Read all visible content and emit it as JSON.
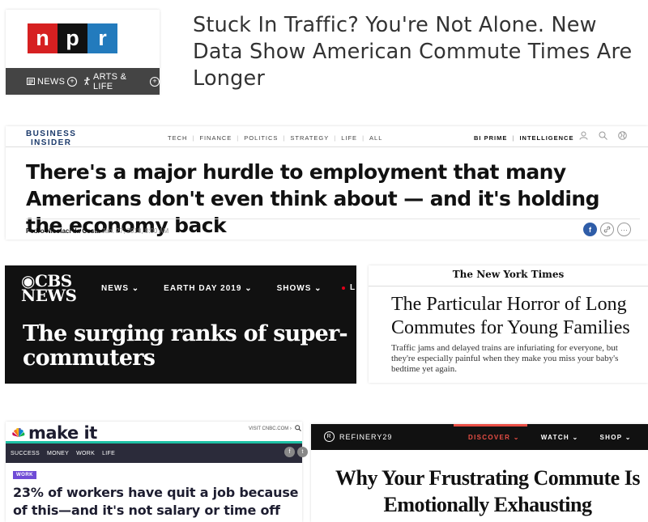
{
  "npr": {
    "logo_letters": [
      "n",
      "p",
      "r"
    ],
    "logo_colors": [
      "#d62021",
      "#111111",
      "#237bbd"
    ],
    "nav": [
      {
        "label": "NEWS",
        "icon": "list-icon"
      },
      {
        "label": "ARTS & LIFE",
        "icon": "dancer-icon"
      }
    ],
    "headline": "Stuck In Traffic? You're Not Alone. New Data Show American Commute Times Are Longer"
  },
  "business_insider": {
    "logo_line1": "BUSINESS",
    "logo_line2": "INSIDER",
    "nav": [
      "TECH",
      "FINANCE",
      "POLITICS",
      "STRATEGY",
      "LIFE",
      "ALL"
    ],
    "right_nav": [
      "BI PRIME",
      "INTELLIGENCE"
    ],
    "headline": "There's a major hurdle to employment that many Americans don't even think about — and it's holding the economy back",
    "author": "Pedro Nicolaci da Costa",
    "date": "Jan. 27, 2018, 8:00 AM",
    "share_icons": [
      "facebook-icon",
      "link-icon",
      "more-icon"
    ]
  },
  "cbs": {
    "logo_line1": "CBS",
    "logo_line2": "NEWS",
    "nav": [
      "NEWS",
      "EARTH DAY 2019",
      "SHOWS"
    ],
    "nav_partial": "L",
    "headline": "The surging ranks of super-commuters"
  },
  "nyt": {
    "logo": "The New York Times",
    "headline": "The Particular Horror of Long Commutes for Young Families",
    "summary": "Traffic jams and delayed trains are infuriating for everyone, but they're especially painful when they make you miss your baby's bedtime yet again."
  },
  "cnbc": {
    "wordmark": "make it",
    "visit_text": "VISIT CNBC.COM",
    "nav": [
      "SUCCESS",
      "MONEY",
      "WORK",
      "LIFE"
    ],
    "tag": "WORK",
    "headline": "23% of workers have quit a job because of this—and it's not salary or time off",
    "accent_color": "#1ec1a5"
  },
  "refinery29": {
    "logo_text": "REFINERY29",
    "nav": [
      {
        "label": "DISCOVER",
        "active": true
      },
      {
        "label": "WATCH",
        "active": false
      },
      {
        "label": "SHOP",
        "active": false
      }
    ],
    "headline": "Why Your Frustrating Commute Is Emotionally Exhausting",
    "accent_color": "#e94e45"
  }
}
